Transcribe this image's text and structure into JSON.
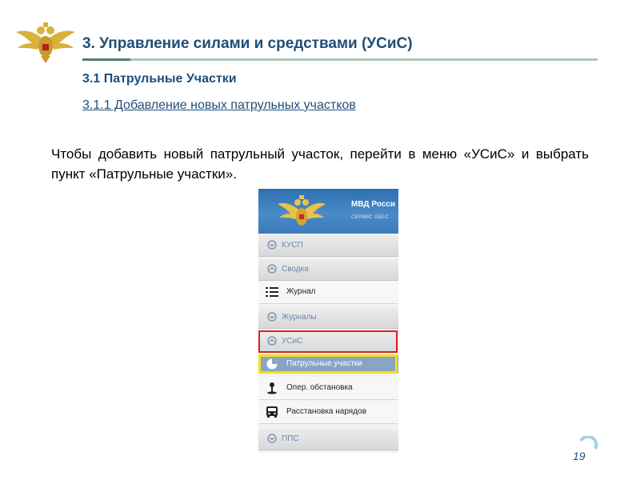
{
  "header": {
    "title": "3. Управление силами и средствами (УСиС)"
  },
  "section": {
    "title": "3.1 Патрульные Участки",
    "subsection": "3.1.1 Добавление новых патрульных участков"
  },
  "body": {
    "paragraph": "Чтобы добавить новый патрульный участок, перейти в меню «УСиС» и выбрать пункт «Патрульные участки»."
  },
  "screenshot": {
    "app_title": "МВД Росси",
    "app_subtitle": "СЕРВИС ОБЕС",
    "menu": {
      "kusp": "КУСП",
      "svodka": "Сводка",
      "zhurnal": "Журнал",
      "zhurnaly": "Журналы",
      "usis": "УСиС",
      "patrol": "Патрульные участки",
      "oper": "Опер. обстановка",
      "rasstanovka": "Расстановка нарядов",
      "pps": "ППС"
    }
  },
  "footer": {
    "page_number": "19"
  }
}
